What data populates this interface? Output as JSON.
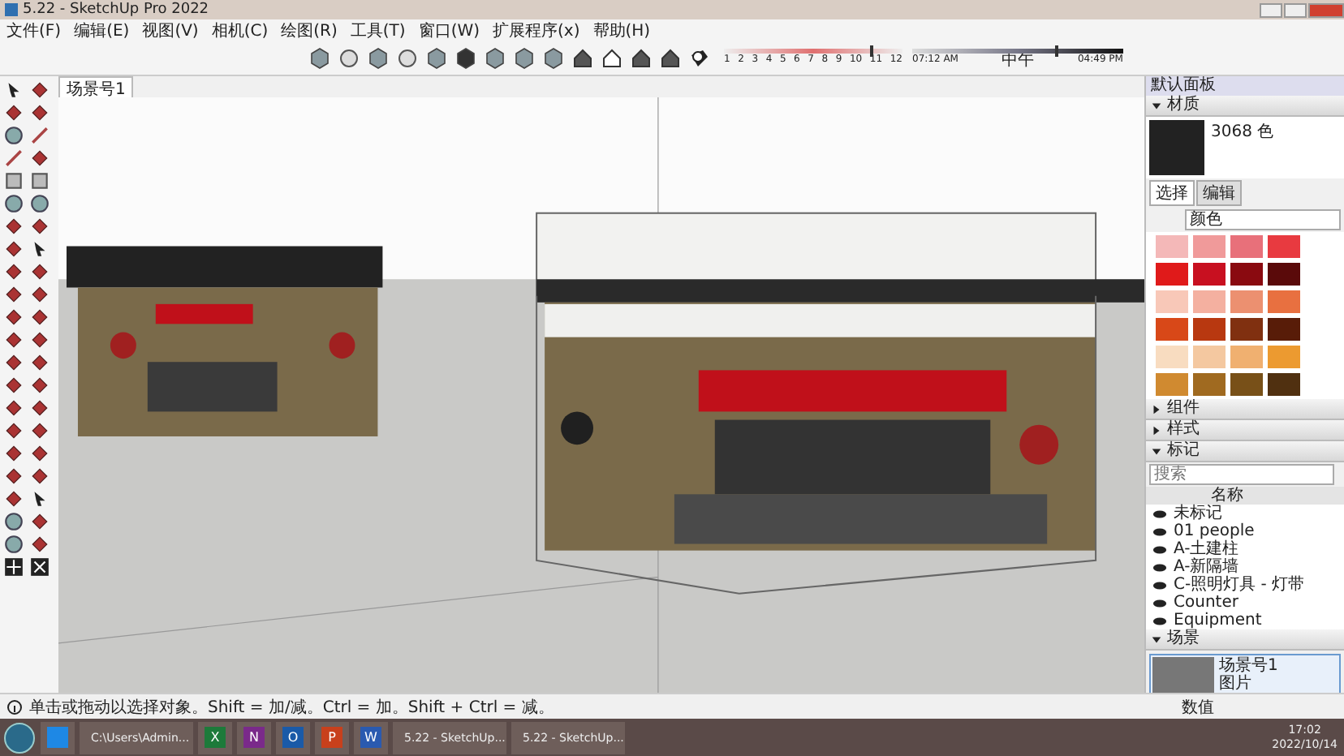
{
  "window": {
    "title": "5.22 - SketchUp Pro 2022"
  },
  "menu": [
    "文件(F)",
    "编辑(E)",
    "视图(V)",
    "相机(C)",
    "绘图(R)",
    "工具(T)",
    "窗口(W)",
    "扩展程序(x)",
    "帮助(H)"
  ],
  "shadow": {
    "months": [
      "1",
      "2",
      "3",
      "4",
      "5",
      "6",
      "7",
      "8",
      "9",
      "10",
      "11",
      "12"
    ],
    "month_slider": {
      "level": 0.82
    },
    "time_start": "07:12 AM",
    "time_mid": "中午",
    "time_end": "04:49 PM",
    "time_slider": {
      "level": 0.68
    }
  },
  "scene_tabs": [
    {
      "label": "场景号1",
      "selected": true
    }
  ],
  "tray": {
    "title": "默认面板",
    "materials": {
      "title": "材质",
      "expanded": true,
      "current": "3068 色",
      "tabs": [
        {
          "label": "选择",
          "selected": true
        },
        {
          "label": "编辑",
          "selected": false
        }
      ],
      "library": "颜色",
      "swatches": [
        {
          "color": "#f4b8b8"
        },
        {
          "color": "#f09a9a"
        },
        {
          "color": "#e8707a"
        },
        {
          "color": "#e83a40"
        },
        {
          "color": "#e01a1a"
        },
        {
          "color": "#c81020"
        },
        {
          "color": "#8a0a10"
        },
        {
          "color": "#5a0a0a"
        },
        {
          "color": "#f8c8b8"
        },
        {
          "color": "#f4b0a0"
        },
        {
          "color": "#ec9070"
        },
        {
          "color": "#e87040"
        },
        {
          "color": "#d84818"
        },
        {
          "color": "#b83810"
        },
        {
          "color": "#803010"
        },
        {
          "color": "#581c08"
        },
        {
          "color": "#f8dcc0"
        },
        {
          "color": "#f4c8a0"
        },
        {
          "color": "#f0b070"
        },
        {
          "color": "#ec9a30"
        },
        {
          "color": "#d08a30"
        },
        {
          "color": "#a06a20"
        },
        {
          "color": "#785018"
        },
        {
          "color": "#503010"
        }
      ]
    },
    "sections": [
      {
        "title": "组件",
        "expanded": false
      },
      {
        "title": "样式",
        "expanded": false
      }
    ],
    "tags": {
      "title": "标记",
      "expanded": true,
      "search_placeholder": "搜索",
      "column": "名称",
      "items": [
        {
          "name": "未标记",
          "visible": true
        },
        {
          "name": "01 people",
          "visible": true
        },
        {
          "name": "A-土建柱",
          "visible": true
        },
        {
          "name": "A-新隔墙",
          "visible": true
        },
        {
          "name": "C-照明灯具 - 灯带",
          "visible": true
        },
        {
          "name": "Counter",
          "visible": true
        },
        {
          "name": "Equipment",
          "visible": true
        }
      ]
    },
    "scenes": {
      "title": "场景",
      "expanded": true,
      "items": [
        {
          "name": "场景号1",
          "description": "图片",
          "selected": true
        }
      ]
    }
  },
  "status_bar": {
    "hint": "单击或拖动以选择对象。Shift = 加/减。Ctrl = 加。Shift + Ctrl = 减。",
    "measurements_label": "数值"
  },
  "taskbar": {
    "items": [
      {
        "kind": "ie"
      },
      {
        "kind": "folder",
        "label": "C:\\Users\\Admin..."
      },
      {
        "kind": "excel",
        "letter": "X"
      },
      {
        "kind": "onenote",
        "letter": "N"
      },
      {
        "kind": "outlook",
        "letter": "O"
      },
      {
        "kind": "powerpoint",
        "letter": "P"
      },
      {
        "kind": "word",
        "letter": "W"
      },
      {
        "kind": "sketchup",
        "label": "5.22 - SketchUp..."
      },
      {
        "kind": "sketchup",
        "label": "5.22 - SketchUp..."
      }
    ],
    "time": "17:02",
    "date": "2022/10/14"
  }
}
